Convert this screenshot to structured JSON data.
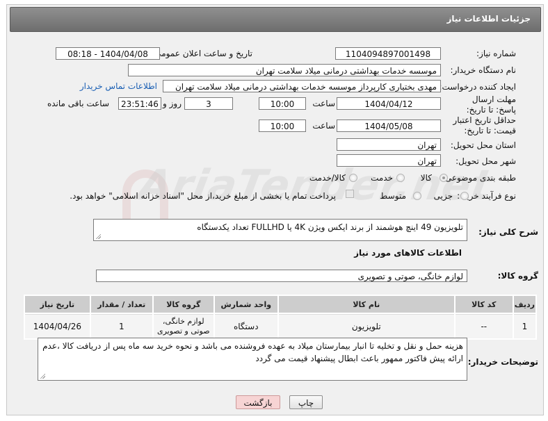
{
  "header": {
    "title": "جزئیات اطلاعات نیاز"
  },
  "watermark": {
    "text": "AriaTender.net"
  },
  "fields": {
    "need_number_label": "شماره نیاز:",
    "need_number_value": "1104094897001498",
    "announce_label": "تاریخ و ساعت اعلان عمومی:",
    "announce_value": "1404/04/08 - 08:18",
    "buyer_org_label": "نام دستگاه خریدار:",
    "buyer_org_value": "موسسه خدمات بهداشتی درمانی میلاد سلامت تهران",
    "requester_label": "ایجاد کننده درخواست:",
    "requester_value": "مهدی بختیاری کارپرداز موسسه خدمات بهداشتی درمانی میلاد سلامت تهران",
    "contact_link": "اطلاعات تماس خریدار",
    "deadline_label": "مهلت ارسال پاسخ: تا تاریخ:",
    "deadline_date": "1404/04/12",
    "time_label": "ساعت",
    "deadline_time": "10:00",
    "days_value": "3",
    "days_label": "روز و",
    "remaining_time": "23:51:46",
    "remaining_label": "ساعت باقی مانده",
    "validity_label": "حداقل تاریخ اعتبار قیمت: تا تاریخ:",
    "validity_date": "1404/05/08",
    "validity_time": "10:00",
    "province_label": "استان محل تحویل:",
    "province_value": "تهران",
    "city_label": "شهر محل تحویل:",
    "city_value": "تهران",
    "category_label": "طبقه بندی موضوعی:",
    "category_options": [
      "کالا",
      "خدمت",
      "کالا/خدمت"
    ],
    "category_selected": "کالا",
    "process_label": "نوع فرآیند خرید :",
    "process_options": [
      "جزیی",
      "متوسط"
    ],
    "payment_note": "پرداخت تمام یا بخشی از مبلغ خرید،از محل \"اسناد خزانه اسلامی\" خواهد بود.",
    "summary_label": "شرح کلی نیاز:",
    "summary_value": "تلویزیون 49 اینچ هوشمند از برند ایکس ویژن 4K یا FULLHD تعداد یکدستگاه",
    "goods_info_title": "اطلاعات کالاهای مورد نیاز",
    "goods_group_label": "گروه کالا:",
    "goods_group_value": "لوازم خانگی، صوتی و تصویری",
    "buyer_notes_label": "توضیحات خریدار:",
    "buyer_notes_value": "هزینه حمل و نقل و تخلیه تا انبار بیمارستان میلاد به عهده فروشنده می باشد و نحوه خرید سه ماه پس از دریافت کالا ،عدم ارائه پیش فاکتور ممهور باعث ابطال پیشنهاد قیمت می گردد"
  },
  "table": {
    "headers": [
      "ردیف",
      "کد کالا",
      "نام کالا",
      "واحد شمارش",
      "گروه کالا",
      "تعداد / مقدار",
      "تاریخ نیاز"
    ],
    "rows": [
      {
        "row": "1",
        "code": "--",
        "name": "تلویزیون",
        "unit": "دستگاه",
        "group": "لوازم خانگی، صوتی و تصویری",
        "qty": "1",
        "date": "1404/04/26"
      }
    ]
  },
  "buttons": {
    "print": "چاپ",
    "back": "بازگشت"
  }
}
